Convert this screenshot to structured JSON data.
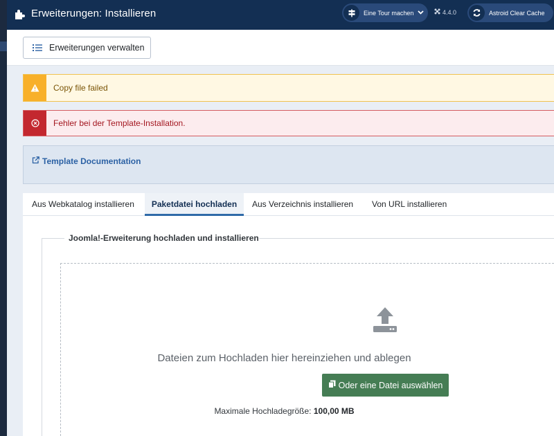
{
  "header": {
    "title": "Erweiterungen: Installieren",
    "tour_label": "Eine Tour machen",
    "version": "4.4.0",
    "cache_label": "Astroid Clear Cache",
    "bg_color": "#132f53"
  },
  "toolbar": {
    "manage_label": "Erweiterungen verwalten",
    "manage_icon": "list-icon"
  },
  "alerts": {
    "warning": {
      "message": "Copy file failed",
      "icon": "warning-triangle-icon",
      "color": "#f8b02a"
    },
    "error": {
      "message": "Fehler bei der Template-Installation.",
      "icon": "circle-x-icon",
      "color": "#c3282f"
    }
  },
  "documentation": {
    "link_label": "Template Documentation",
    "icon": "external-link-icon"
  },
  "tabs": [
    {
      "label": "Aus Webkatalog installieren",
      "active": false
    },
    {
      "label": "Paketdatei hochladen",
      "active": true
    },
    {
      "label": "Aus Verzeichnis installieren",
      "active": false
    },
    {
      "label": "Von URL installieren",
      "active": false
    }
  ],
  "upload": {
    "legend": "Joomla!-Erweiterung hochladen und installieren",
    "drop_text": "Dateien zum Hochladen hier hereinziehen und ablegen",
    "select_button": "Oder eine Datei auswählen",
    "max_size_label": "Maximale Hochladegröße:",
    "max_size_value": "100,00 MB",
    "button_color": "#457d54"
  }
}
